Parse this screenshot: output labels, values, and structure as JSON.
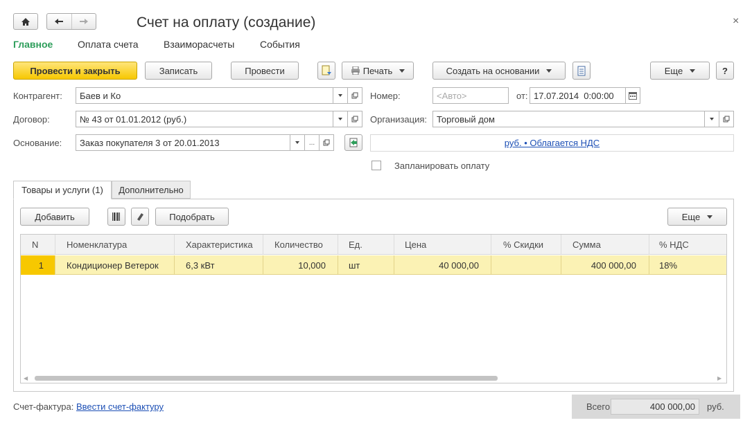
{
  "window": {
    "title": "Счет на оплату (создание)"
  },
  "nav": {
    "tabs": [
      "Главное",
      "Оплата счета",
      "Взаиморасчеты",
      "События"
    ]
  },
  "toolbar": {
    "post_close": "Провести и закрыть",
    "save": "Записать",
    "post": "Провести",
    "print": "Печать",
    "create_based": "Создать на основании",
    "more": "Еще",
    "help": "?"
  },
  "form": {
    "counterparty_label": "Контрагент:",
    "counterparty_value": "Баев и Ко",
    "contract_label": "Договор:",
    "contract_value": "№ 43 от 01.01.2012 (руб.)",
    "basis_label": "Основание:",
    "basis_value": "Заказ покупателя 3 от 20.01.2013",
    "number_label": "Номер:",
    "number_placeholder": "<Авто>",
    "date_label": "от:",
    "date_value": "17.07.2014  0:00:00",
    "org_label": "Организация:",
    "org_value": "Торговый дом",
    "currency_link": "руб. • Облагается НДС",
    "plan_payment_label": "Запланировать оплату",
    "plan_payment_checked": false
  },
  "tabs": {
    "goods": "Товары и услуги (1)",
    "extra": "Дополнительно"
  },
  "table_toolbar": {
    "add": "Добавить",
    "pick": "Подобрать",
    "more": "Еще"
  },
  "table": {
    "columns": [
      "N",
      "Номенклатура",
      "Характеристика",
      "Количество",
      "Ед.",
      "Цена",
      "% Скидки",
      "Сумма",
      "% НДС"
    ],
    "rows": [
      {
        "n": "1",
        "item": "Кондиционер Ветерок",
        "char": "6,3 кВт",
        "qty": "10,000",
        "unit": "шт",
        "price": "40 000,00",
        "discount": "",
        "sum": "400 000,00",
        "vat": "18%"
      }
    ]
  },
  "footer": {
    "invoice_label": "Счет-фактура:",
    "invoice_link": "Ввести счет-фактуру",
    "total_label": "Всего:",
    "total_value": "400 000,00",
    "total_currency": "руб."
  },
  "colors": {
    "accent_green": "#2e9e5b",
    "primary_button": "#f7c800",
    "selected_row": "#fbf2b4"
  }
}
